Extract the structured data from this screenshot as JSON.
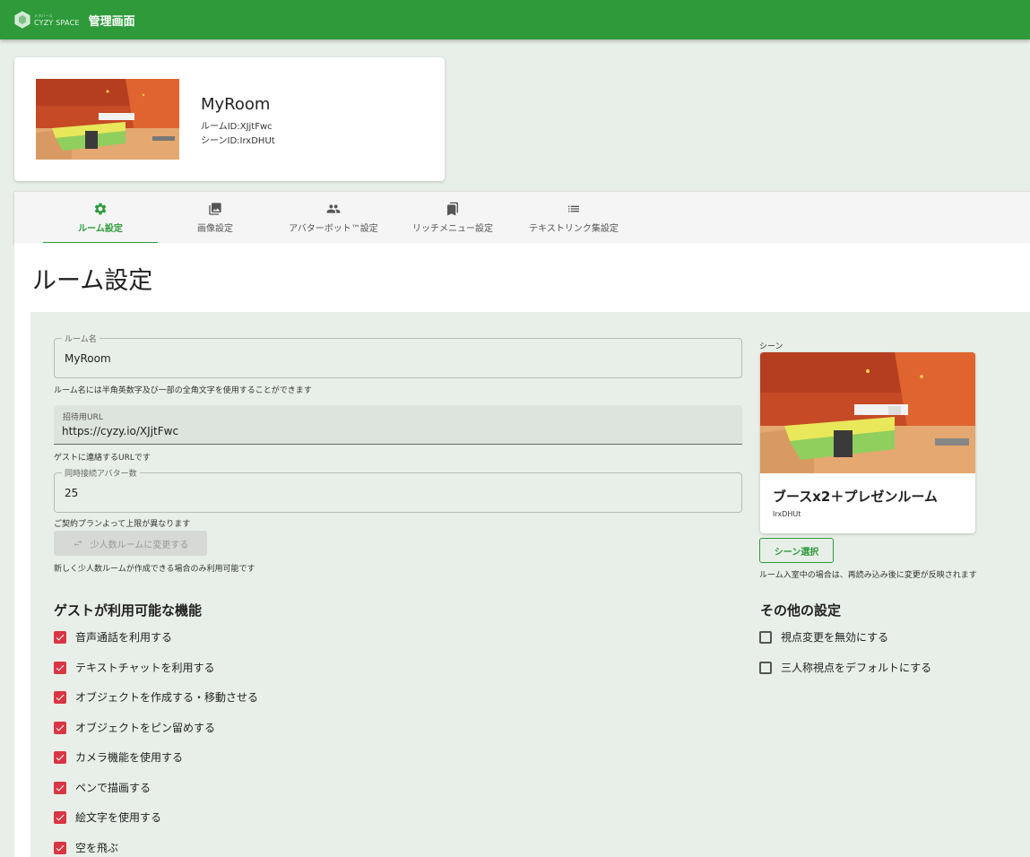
{
  "appbar": {
    "brand": "CYZY SPACE",
    "brand_small": "メタバース",
    "title": "管理画面"
  },
  "room": {
    "name": "MyRoom",
    "room_id": "ルームID:XJjtFwc",
    "scene_id": "シーンID:IrxDHUt"
  },
  "tabs": [
    {
      "label": "ルーム設定",
      "icon": "gear-icon",
      "active": true
    },
    {
      "label": "画像設定",
      "icon": "image-icon",
      "active": false
    },
    {
      "label": "アバターボット™設定",
      "icon": "people-icon",
      "active": false
    },
    {
      "label": "リッチメニュー設定",
      "icon": "bookmark-icon",
      "active": false
    },
    {
      "label": "テキストリンク集設定",
      "icon": "list-icon",
      "active": false
    }
  ],
  "page_title": "ルーム設定",
  "form": {
    "room_name": {
      "label": "ルーム名",
      "value": "MyRoom",
      "helper": "ルーム名には半角英数字及び一部の全角文字を使用することができます"
    },
    "invite_url": {
      "label": "招待用URL",
      "value": "https://cyzy.io/XJjtFwc",
      "helper": "ゲストに連絡するURLです"
    },
    "max_avatars": {
      "label": "同時接続アバター数",
      "value": "25",
      "helper": "ご契約プランよって上限が異なります"
    },
    "small_room_button": "少人数ルームに変更する",
    "small_room_helper": "新しく少人数ルームが作成できる場合のみ利用可能です"
  },
  "guest_features": {
    "title": "ゲストが利用可能な機能",
    "items": [
      {
        "label": "音声通話を利用する",
        "checked": true
      },
      {
        "label": "テキストチャットを利用する",
        "checked": true
      },
      {
        "label": "オブジェクトを作成する・移動させる",
        "checked": true
      },
      {
        "label": "オブジェクトをピン留めする",
        "checked": true
      },
      {
        "label": "カメラ機能を使用する",
        "checked": true
      },
      {
        "label": "ペンで描画する",
        "checked": true
      },
      {
        "label": "絵文字を使用する",
        "checked": true
      },
      {
        "label": "空を飛ぶ",
        "checked": true
      }
    ]
  },
  "scene": {
    "label": "シーン",
    "name": "ブースx2＋プレゼンルーム",
    "id": "IrxDHUt",
    "select_button": "シーン選択",
    "helper": "ルーム入室中の場合は、再読み込み後に変更が反映されます"
  },
  "other_settings": {
    "title": "その他の設定",
    "items": [
      {
        "label": "視点変更を無効にする",
        "checked": false
      },
      {
        "label": "三人称視点をデフォルトにする",
        "checked": false
      }
    ]
  },
  "colors": {
    "primary": "#2e9a3a",
    "checkbox": "#d83545",
    "panel_bg": "#e8efe8"
  }
}
